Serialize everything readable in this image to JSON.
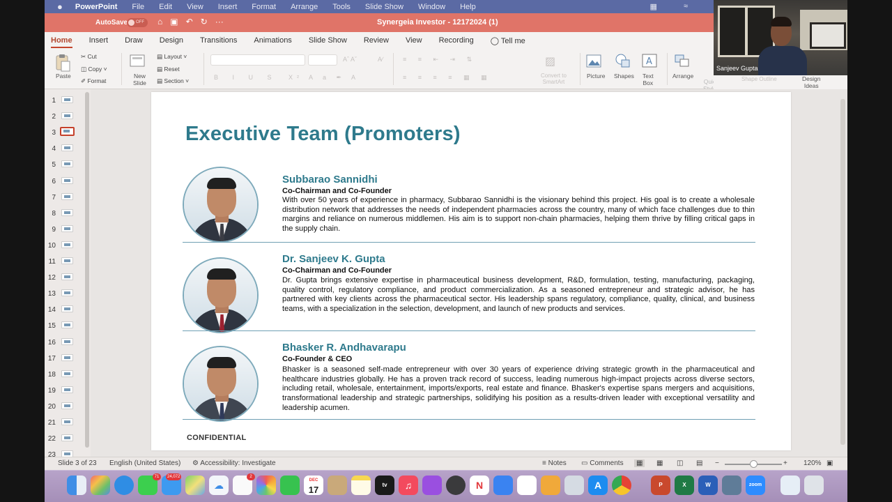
{
  "menubar": {
    "app_name": "PowerPoint",
    "items": [
      "File",
      "Edit",
      "View",
      "Insert",
      "Format",
      "Arrange",
      "Tools",
      "Slide Show",
      "Window",
      "Help"
    ]
  },
  "titlebar": {
    "autosave_label": "AutoSave",
    "autosave_state": "OFF",
    "document_title": "Synergeia Investor - 12172024 (1)"
  },
  "ribbon": {
    "tabs": [
      "Home",
      "Insert",
      "Draw",
      "Design",
      "Transitions",
      "Animations",
      "Slide Show",
      "Review",
      "View",
      "Recording",
      "Tell me"
    ],
    "active_tab": "Home",
    "paste": "Paste",
    "cut": "Cut",
    "copy": "Copy",
    "format": "Format",
    "new_slide": "New\nSlide",
    "layout": "Layout",
    "reset": "Reset",
    "section": "Section",
    "convert_smartart": "Convert to\nSmartArt",
    "picture": "Picture",
    "shapes": "Shapes",
    "text_box": "Text\nBox",
    "arrange": "Arrange",
    "quick_styles": "Quick\nStyles",
    "shape_outline": "Shape Outline",
    "design_ideas": "Design\nIdeas"
  },
  "video": {
    "participant_name": "Sanjeev Gupta"
  },
  "thumbnails": {
    "numbers": [
      "1",
      "2",
      "3",
      "4",
      "5",
      "6",
      "7",
      "8",
      "9",
      "10",
      "11",
      "12",
      "13",
      "14",
      "15",
      "16",
      "17",
      "18",
      "19",
      "20",
      "21",
      "22",
      "23"
    ],
    "selected": 3
  },
  "slide": {
    "title": "Executive Team (Promoters)",
    "members": [
      {
        "name": "Subbarao Sannidhi",
        "role": "Co-Chairman and Co-Founder",
        "bio": "With over 50 years of experience in pharmacy, Subbarao Sannidhi is the visionary behind this project. His goal is to create a wholesale distribution network that addresses the needs of independent pharmacies across the country, many of which face challenges due to thin margins and reliance on numerous middlemen. His aim is to support non-chain pharmacies, helping them thrive by filling critical gaps in the supply chain."
      },
      {
        "name": "Dr. Sanjeev K. Gupta",
        "role": "Co-Chairman and Co-Founder",
        "bio": "Dr. Gupta brings extensive expertise in pharmaceutical business development, R&D, formulation, testing, manufacturing, packaging, quality control, regulatory compliance, and product commercialization. As a seasoned entrepreneur and strategic advisor, he has partnered with key clients across the pharmaceutical sector. His leadership spans regulatory, compliance, quality, clinical, and business teams, with a specialization in the selection, development, and launch of new products and services."
      },
      {
        "name": "Bhasker R. Andhavarapu",
        "role": "Co-Founder & CEO",
        "bio": "Bhasker is a seasoned self-made entrepreneur with over 30 years of experience driving strategic growth in the pharmaceutical and healthcare industries globally. He has a proven track record of success, leading numerous high-impact projects across diverse sectors, including retail, wholesale, entertainment, imports/exports, real estate and finance. Bhasker's expertise spans mergers and acquisitions, transformational leadership and strategic partnerships, solidifying his position as a results-driven leader with exceptional versatility and leadership acumen."
      }
    ],
    "footer": "CONFIDENTIAL"
  },
  "statusbar": {
    "slide_info": "Slide 3 of 23",
    "language": "English (United States)",
    "accessibility": "Accessibility: Investigate",
    "notes": "Notes",
    "comments": "Comments",
    "zoom_level": "120%"
  },
  "dock": {
    "calendar_month": "DEC",
    "calendar_day": "17",
    "mail_badge": "24,072",
    "messages_badge": "71",
    "reminders_badge": "2",
    "tv_label": "tv",
    "zoom_label": "zoom"
  }
}
